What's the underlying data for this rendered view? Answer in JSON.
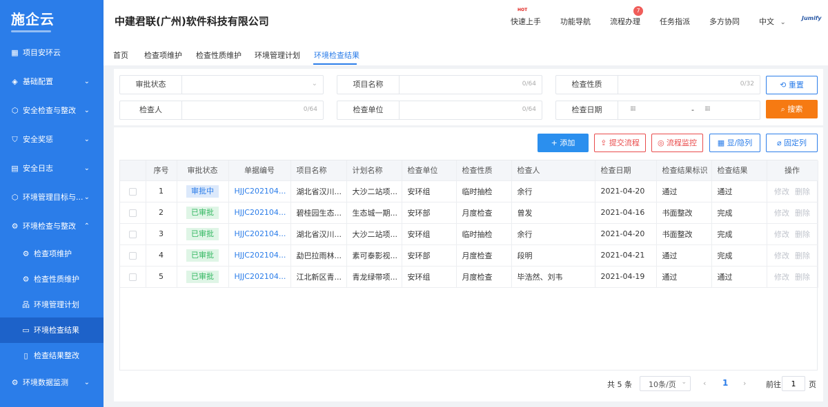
{
  "brand": "施企云",
  "sidebar": {
    "items": [
      {
        "icon": "▦",
        "label": "项目安环云",
        "chev": ""
      },
      {
        "icon": "◈",
        "label": "基础配置",
        "chev": "⌄"
      },
      {
        "icon": "⬡",
        "label": "安全检查与整改",
        "chev": "⌄"
      },
      {
        "icon": "⛉",
        "label": "安全奖惩",
        "chev": "⌄"
      },
      {
        "icon": "▤",
        "label": "安全日志",
        "chev": "⌄"
      },
      {
        "icon": "⬡",
        "label": "环境管理目标与...",
        "chev": "⌄"
      },
      {
        "icon": "⚙",
        "label": "环境检查与整改",
        "chev": "⌃"
      },
      {
        "icon": "⚙",
        "label": "检查项维护",
        "chev": ""
      },
      {
        "icon": "⚙",
        "label": "检查性质维护",
        "chev": ""
      },
      {
        "icon": "品",
        "label": "环境管理计划",
        "chev": ""
      },
      {
        "icon": "▭",
        "label": "环境检查结果",
        "chev": ""
      },
      {
        "icon": "▯",
        "label": "检查结果整改",
        "chev": ""
      },
      {
        "icon": "⚙",
        "label": "环境数据监测",
        "chev": "⌄"
      }
    ]
  },
  "header": {
    "company": "中建君联(广州)软件科技有限公司",
    "nav": [
      "快速上手",
      "功能导航",
      "流程办理",
      "任务指派",
      "多方协同",
      "中文"
    ],
    "hot": "HOT",
    "badge": "7",
    "lang_chev": "⌄",
    "logo": "Jumify"
  },
  "tabs": [
    "首页",
    "检查项维护",
    "检查性质维护",
    "环境管理计划",
    "环境检查结果"
  ],
  "filter": {
    "approval_status": "审批状态",
    "project_name": "项目名称",
    "project_count": "0/64",
    "inspection_nature": "检查性质",
    "nature_count": "0/32",
    "inspector": "检查人",
    "inspector_count": "0/64",
    "inspection_unit": "检查单位",
    "unit_count": "0/64",
    "inspection_date": "检查日期",
    "date_sep": "-",
    "reset": "重置",
    "search": "搜索"
  },
  "toolbar": {
    "add": "添加",
    "submit": "提交流程",
    "monitor": "流程监控",
    "columns": "显/隐列",
    "fix": "固定列"
  },
  "table": {
    "headers": [
      "序号",
      "审批状态",
      "单据编号",
      "项目名称",
      "计划名称",
      "检查单位",
      "检查性质",
      "检查人",
      "检查日期",
      "检查结果标识",
      "检查结果",
      "操作"
    ],
    "rows": [
      {
        "no": "1",
        "status": "审批中",
        "code": "HJJC202104...",
        "project": "湖北省汉川...",
        "plan": "大沙二站项...",
        "unit": "安环组",
        "nature": "临时抽检",
        "inspector": "余行",
        "date": "2021-04-20",
        "flag": "通过",
        "result": "通过"
      },
      {
        "no": "2",
        "status": "已审批",
        "code": "HJJC202104...",
        "project": "碧桂园生态...",
        "plan": "生态城一期...",
        "unit": "安环部",
        "nature": "月度检查",
        "inspector": "曾发",
        "date": "2021-04-16",
        "flag": "书面整改",
        "result": "完成"
      },
      {
        "no": "3",
        "status": "已审批",
        "code": "HJJC202104...",
        "project": "湖北省汉川...",
        "plan": "大沙二站项...",
        "unit": "安环组",
        "nature": "临时抽检",
        "inspector": "余行",
        "date": "2021-04-20",
        "flag": "书面整改",
        "result": "完成"
      },
      {
        "no": "4",
        "status": "已审批",
        "code": "HJJC202104...",
        "project": "勐巴拉雨林...",
        "plan": "素可泰影视...",
        "unit": "安环部",
        "nature": "月度检查",
        "inspector": "段明",
        "date": "2021-04-21",
        "flag": "通过",
        "result": "完成"
      },
      {
        "no": "5",
        "status": "已审批",
        "code": "HJJC202104...",
        "project": "江北新区青...",
        "plan": "青龙绿带项...",
        "unit": "安环组",
        "nature": "月度检查",
        "inspector": "毕浩然、刘韦",
        "date": "2021-04-19",
        "flag": "通过",
        "result": "通过"
      }
    ],
    "edit": "修改",
    "delete": "删除"
  },
  "pagination": {
    "total": "共 5 条",
    "page_size": "10条/页",
    "current": "1",
    "goto_prefix": "前往",
    "goto_value": "1",
    "goto_suffix": "页"
  },
  "colors": {
    "brand_blue": "#2b7de9",
    "orange": "#f67a12",
    "red": "#e94a4a",
    "green": "#34b862"
  }
}
